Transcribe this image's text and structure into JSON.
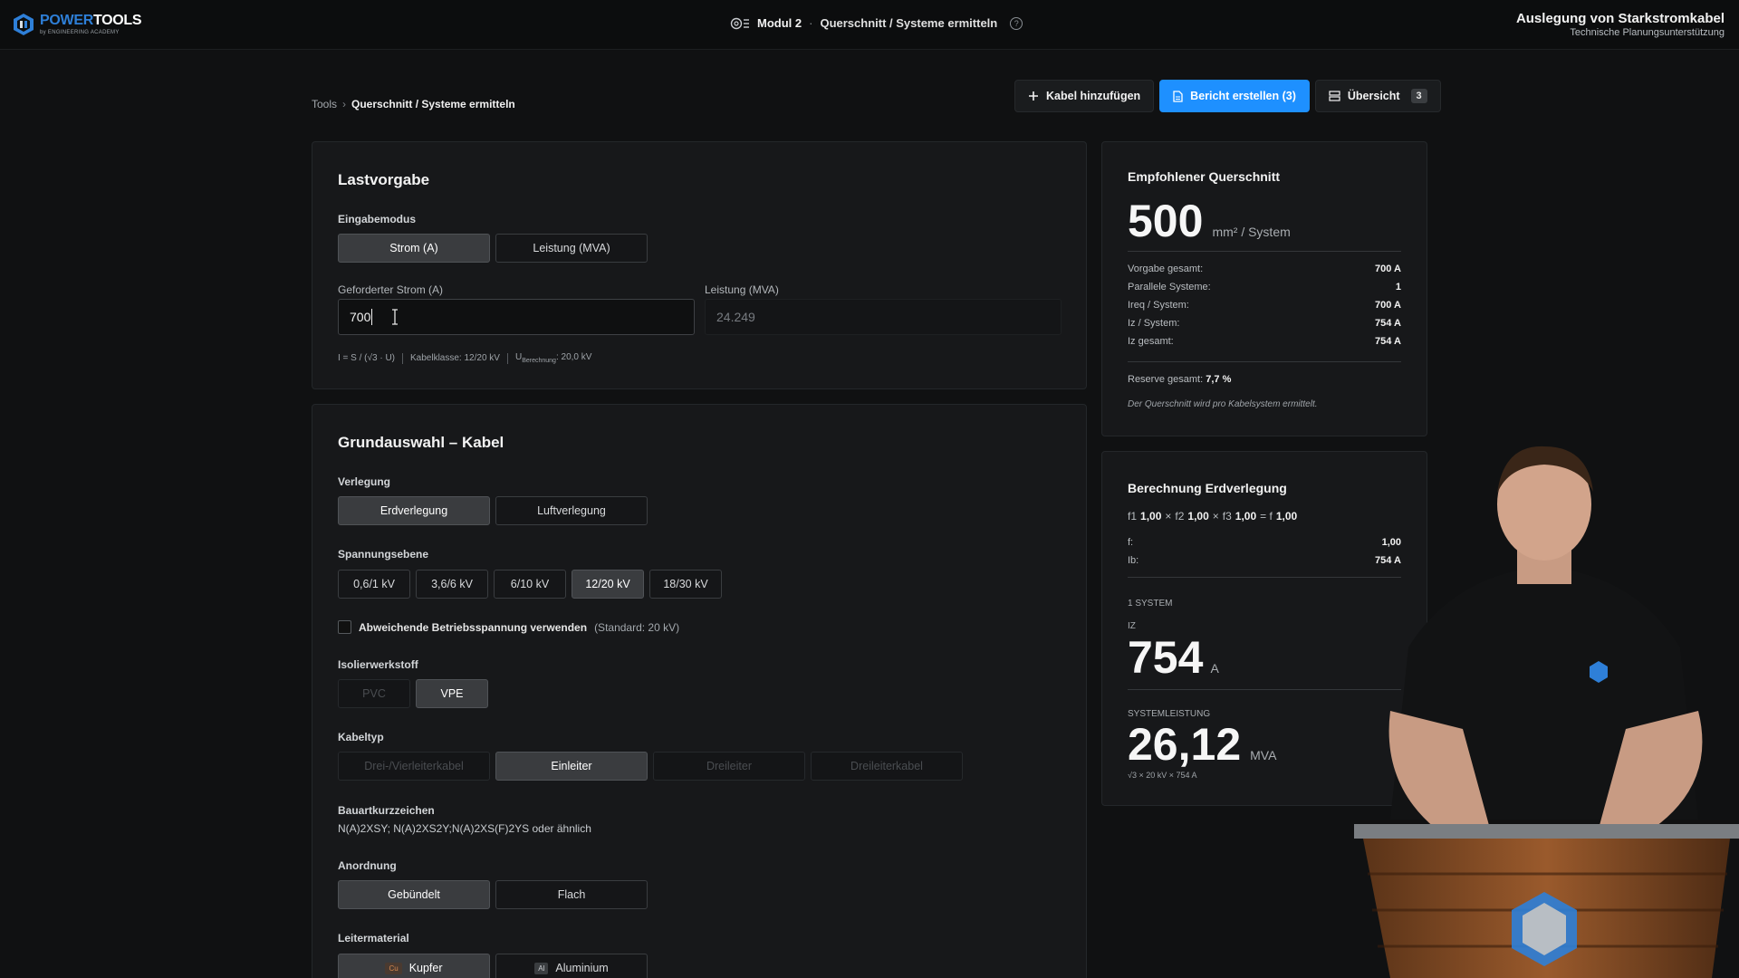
{
  "topbar": {
    "logo_power": "POWER",
    "logo_tools": "TOOLS",
    "logo_sub": "by ENGINEERING ACADEMY",
    "module": "Modul 2",
    "separator": "·",
    "title": "Querschnitt / Systeme ermitteln",
    "help": "?",
    "right_title": "Auslegung von Starkstromkabel",
    "right_sub": "Technische Planungsunterstützung"
  },
  "breadcrumb": {
    "root": "Tools",
    "sep": "›",
    "current": "Querschnitt / Systeme ermitteln"
  },
  "actions": {
    "add_cable": "Kabel hinzufügen",
    "report": "Bericht erstellen (3)",
    "overview": "Übersicht",
    "overview_count": "3"
  },
  "lastvorgabe": {
    "title": "Lastvorgabe",
    "mode_label": "Eingabemodus",
    "mode_options": [
      "Strom (A)",
      "Leistung (MVA)"
    ],
    "mode_selected": "Strom (A)",
    "current_label": "Geforderter Strom (A)",
    "current_value": "700",
    "power_label": "Leistung (MVA)",
    "power_value": "24.249",
    "hint_formula": "I = S / (√3 · U)",
    "hint_class": "Kabelklasse: 12/20 kV",
    "hint_u_main": "U",
    "hint_u_sub": "Berechnung",
    "hint_u_val": ": 20,0 kV"
  },
  "grundauswahl": {
    "title": "Grundauswahl – Kabel",
    "verlegung_label": "Verlegung",
    "verlegung": [
      "Erdverlegung",
      "Luftverlegung"
    ],
    "spannung_label": "Spannungsebene",
    "spannung": [
      "0,6/1 kV",
      "3,6/6 kV",
      "6/10 kV",
      "12/20 kV",
      "18/30 kV"
    ],
    "checkbox_label": "Abweichende Betriebsspannung verwenden",
    "checkbox_note": "(Standard: 20 kV)",
    "iso_label": "Isolierwerkstoff",
    "iso": [
      "PVC",
      "VPE"
    ],
    "kabeltyp_label": "Kabeltyp",
    "kabeltyp": [
      "Drei-/Vierleiterkabel",
      "Einleiter",
      "Dreileiter",
      "Dreileiterkabel"
    ],
    "bauart_label": "Bauartkurzzeichen",
    "bauart_value": "N(A)2XSY; N(A)2XS2Y;N(A)2XS(F)2YS oder ähnlich",
    "anordnung_label": "Anordnung",
    "anordnung": [
      "Gebündelt",
      "Flach"
    ],
    "leiter_label": "Leitermaterial",
    "leiter": [
      {
        "tag": "Cu",
        "label": "Kupfer"
      },
      {
        "tag": "Al",
        "label": "Aluminium"
      }
    ]
  },
  "empfehlung": {
    "title": "Empfohlener Querschnitt",
    "value": "500",
    "unit": "mm² / System",
    "rows": [
      {
        "k": "Vorgabe gesamt:",
        "v": "700 A"
      },
      {
        "k": "Parallele Systeme:",
        "v": "1"
      },
      {
        "k": "Ireq / System:",
        "v": "700 A"
      },
      {
        "k": "Iz / System:",
        "v": "754 A"
      },
      {
        "k": "Iz gesamt:",
        "v": "754 A"
      }
    ],
    "reserve_label": "Reserve gesamt:",
    "reserve_value": "7,7 %",
    "note": "Der Querschnitt wird pro Kabelsystem ermittelt."
  },
  "erdverlegung": {
    "title": "Berechnung Erdverlegung",
    "f1": "f1",
    "f1v": "1,00",
    "x1": "×",
    "f2": "f2",
    "f2v": "1,00",
    "x2": "×",
    "f3": "f3",
    "f3v": "1,00",
    "eq": "= f",
    "fv": "1,00",
    "rows": [
      {
        "k": "f:",
        "v": "1,00"
      },
      {
        "k": "Ib:",
        "v": "754 A"
      }
    ],
    "system_label": "1 SYSTEM",
    "iz_label": "IZ",
    "iz_value": "754",
    "iz_unit": "A",
    "power_label": "SYSTEMLEISTUNG",
    "power_value": "26,12",
    "power_unit": "MVA",
    "power_formula": "√3 × 20 kV × 754 A"
  },
  "colors": {
    "accent": "#1e90ff",
    "bg": "#101112",
    "card": "#17181a"
  }
}
